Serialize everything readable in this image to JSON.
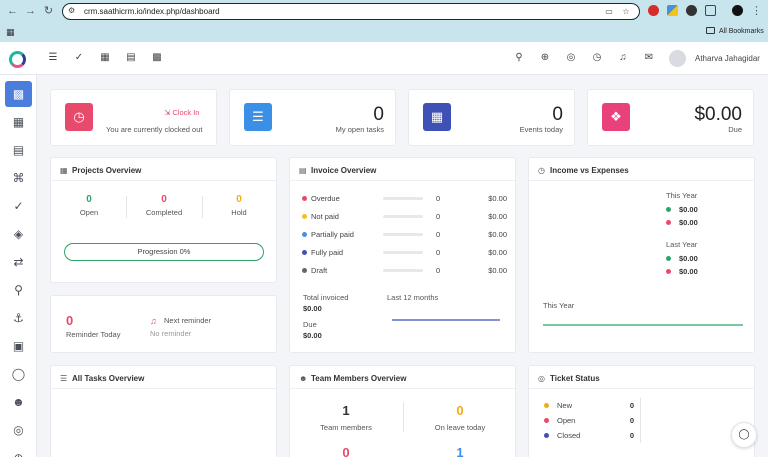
{
  "browser": {
    "url": "crm.saathicrm.io/index.php/dashboard",
    "bookmarks_label": "All Bookmarks"
  },
  "header": {
    "user_name": "Atharva Jahagidar"
  },
  "clock": {
    "link_label": "Clock In",
    "status": "You are currently clocked out"
  },
  "stats": {
    "open_tasks": {
      "value": "0",
      "label": "My open tasks"
    },
    "events_today": {
      "value": "0",
      "label": "Events today"
    },
    "due": {
      "value": "$0.00",
      "label": "Due"
    }
  },
  "projects": {
    "title": "Projects Overview",
    "open": {
      "value": "0",
      "label": "Open",
      "color": "#2ea56b"
    },
    "completed": {
      "value": "0",
      "label": "Completed",
      "color": "#e84a6c"
    },
    "hold": {
      "value": "0",
      "label": "Hold",
      "color": "#f0ad1a"
    },
    "progression": "Progression 0%"
  },
  "reminders": {
    "count": "0",
    "count_label": "Reminder Today",
    "next_label": "Next reminder",
    "next_value": "No reminder"
  },
  "invoice": {
    "title": "Invoice Overview",
    "rows": [
      {
        "name": "Overdue",
        "count": "0",
        "amount": "$0.00",
        "color": "#e84a6c"
      },
      {
        "name": "Not paid",
        "count": "0",
        "amount": "$0.00",
        "color": "#f0c419"
      },
      {
        "name": "Partially paid",
        "count": "0",
        "amount": "$0.00",
        "color": "#4a90e2"
      },
      {
        "name": "Fully paid",
        "count": "0",
        "amount": "$0.00",
        "color": "#3f51b5"
      },
      {
        "name": "Draft",
        "count": "0",
        "amount": "$0.00",
        "color": "#666666"
      }
    ],
    "total_invoiced_label": "Total invoiced",
    "total_invoiced_value": "$0.00",
    "due_label": "Due",
    "due_value": "$0.00",
    "period_label": "Last 12 months"
  },
  "income": {
    "title": "Income vs Expenses",
    "this_year_label": "This Year",
    "this_year_income": "$0.00",
    "this_year_expense": "$0.00",
    "last_year_label": "Last Year",
    "last_year_income": "$0.00",
    "last_year_expense": "$0.00",
    "chart_label": "This Year"
  },
  "tasks": {
    "title": "All Tasks Overview"
  },
  "team": {
    "title": "Team Members Overview",
    "members": {
      "value": "1",
      "label": "Team members"
    },
    "on_leave": {
      "value": "0",
      "label": "On leave today"
    },
    "row2_left": "0",
    "row2_right": "1"
  },
  "tickets": {
    "title": "Ticket Status",
    "rows": [
      {
        "name": "New",
        "count": "0",
        "color": "#f0ad1a"
      },
      {
        "name": "Open",
        "count": "0",
        "color": "#e84a6c"
      },
      {
        "name": "Closed",
        "count": "0",
        "color": "#3f51b5"
      }
    ]
  }
}
